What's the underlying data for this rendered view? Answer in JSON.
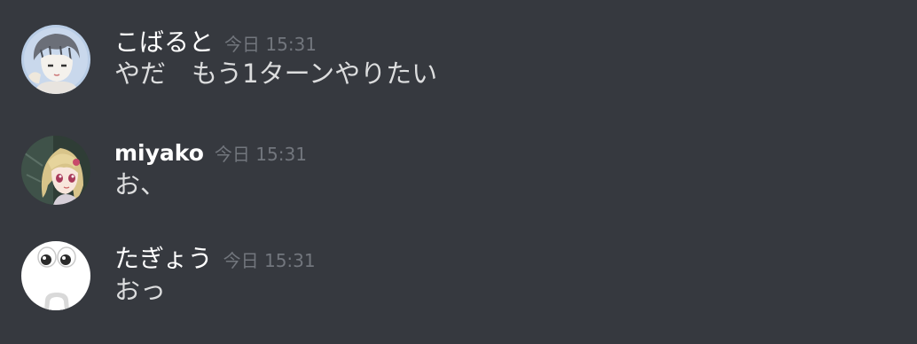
{
  "messages": [
    {
      "username": "こばると",
      "timestamp": "今日 15:31",
      "content": "やだ　もう1ターンやりたい",
      "avatar_icon": "sketch-character-avatar"
    },
    {
      "username": "miyako",
      "timestamp": "今日 15:31",
      "content": "お、",
      "avatar_icon": "anime-girl-avatar"
    },
    {
      "username": "たぎょう",
      "timestamp": "今日 15:31",
      "content": "おっ",
      "avatar_icon": "eyes-face-avatar"
    }
  ],
  "colors": {
    "background": "#36393f",
    "username": "#ffffff",
    "timestamp": "#72767d",
    "message_text": "#dcddde"
  }
}
